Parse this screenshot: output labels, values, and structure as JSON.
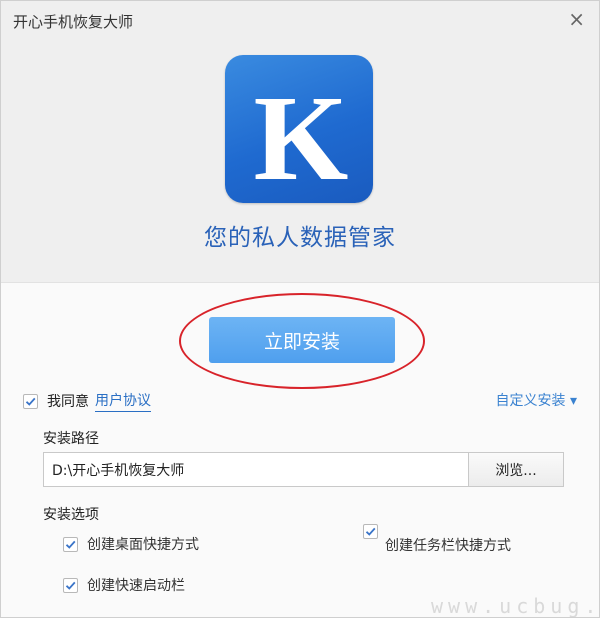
{
  "window": {
    "title": "开心手机恢复大师",
    "close_glyph": "×"
  },
  "hero": {
    "logo_letter": "K",
    "slogan": "您的私人数据管家"
  },
  "install": {
    "button_label": "立即安装"
  },
  "agreement": {
    "checked": true,
    "label": "我同意",
    "link": "用户协议"
  },
  "custom_install": {
    "label": "自定义安装 ▾"
  },
  "path": {
    "label": "安装路径",
    "value": "D:\\开心手机恢复大师",
    "browse_label": "浏览..."
  },
  "options": {
    "label": "安装选项",
    "desktop_shortcut": {
      "checked": true,
      "label": "创建桌面快捷方式"
    },
    "taskbar_shortcut": {
      "checked": true,
      "label": "创建任务栏快捷方式"
    },
    "quick_launch": {
      "checked": true,
      "label": "创建快速启动栏"
    }
  },
  "watermark": "www.ucbug.cc",
  "colors": {
    "accent": "#4f9fee",
    "link": "#2a6fc4",
    "highlight": "#d8232a",
    "logo_blue": "#1f6ad0"
  }
}
